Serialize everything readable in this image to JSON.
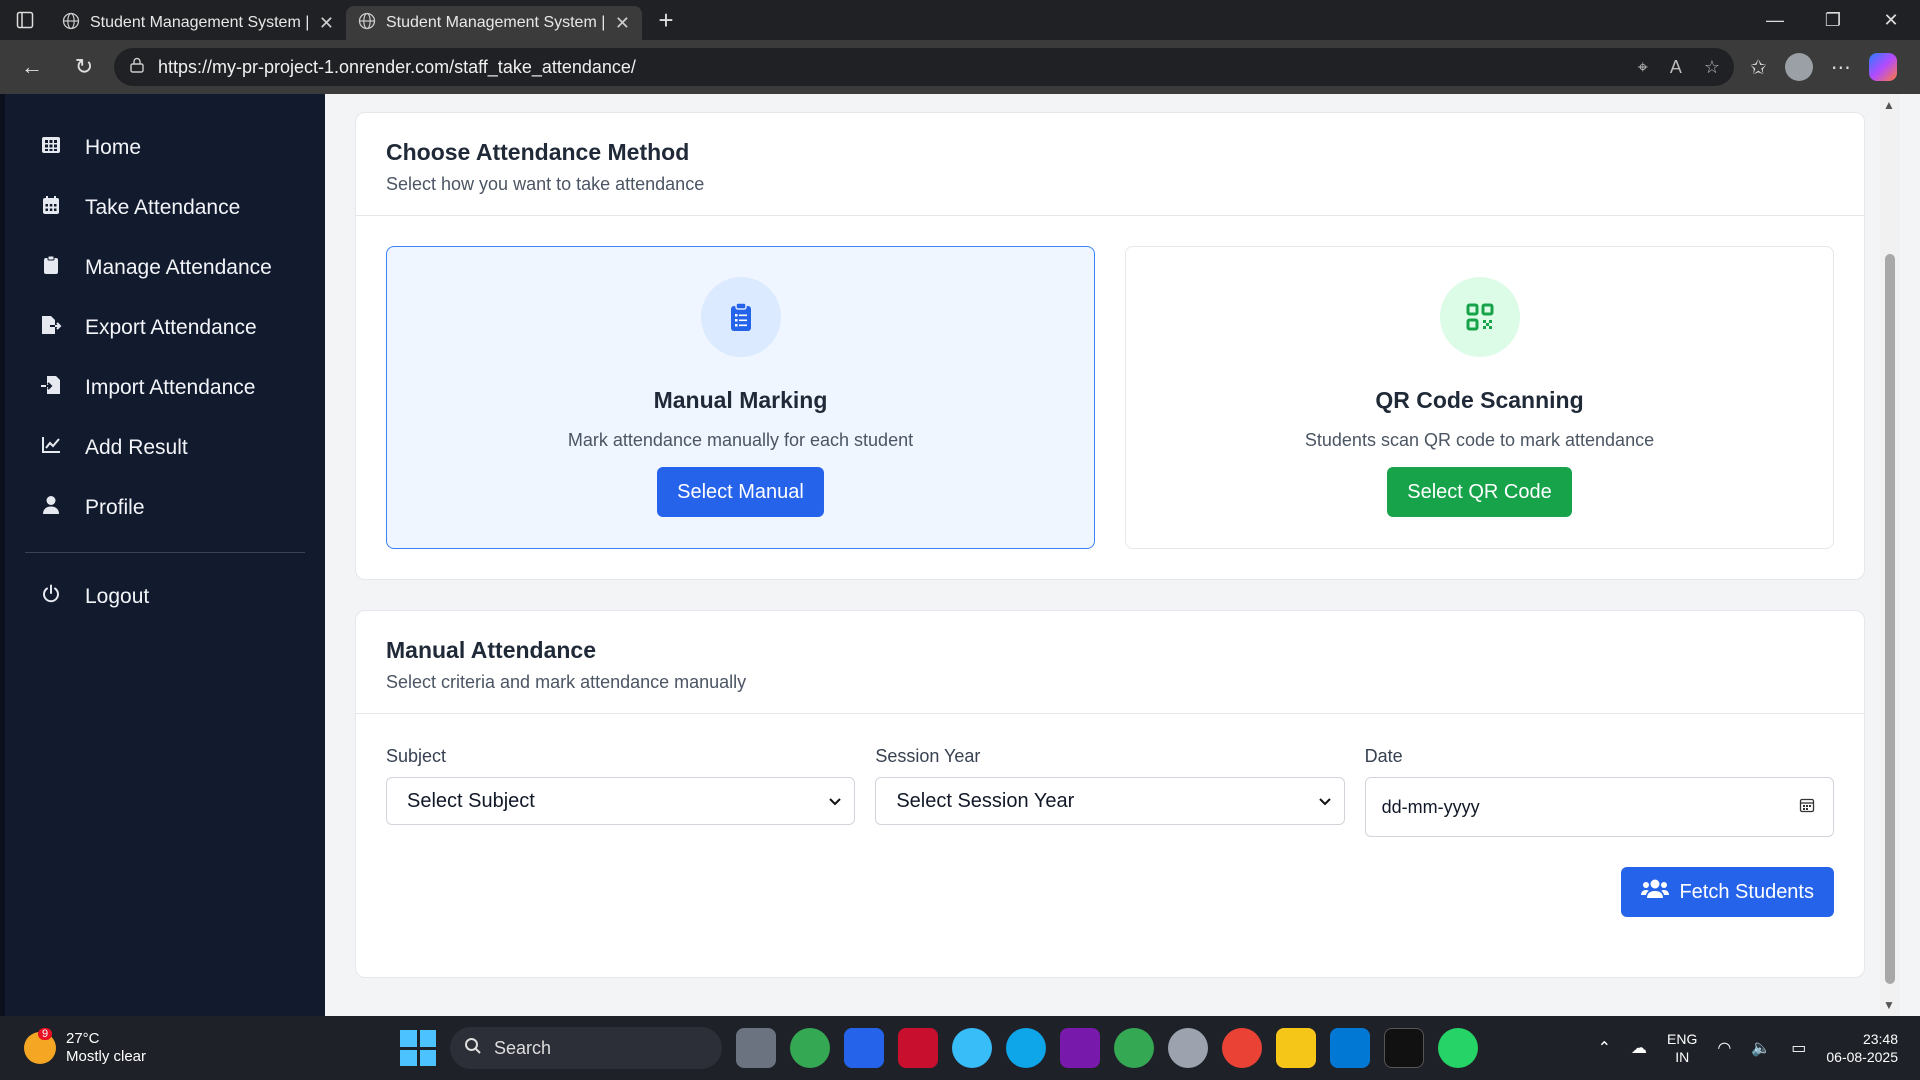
{
  "browser": {
    "tabs": [
      {
        "title": "Student Management System | Dashboard",
        "active": false
      },
      {
        "title": "Student Management System | Staff",
        "active": true
      }
    ],
    "url": "https://my-pr-project-1.onrender.com/staff_take_attendance/"
  },
  "sidebar": {
    "items": [
      {
        "label": "Home",
        "icon": "grid-icon"
      },
      {
        "label": "Take Attendance",
        "icon": "calendar-icon"
      },
      {
        "label": "Manage Attendance",
        "icon": "clipboard-icon"
      },
      {
        "label": "Export Attendance",
        "icon": "file-export-icon"
      },
      {
        "label": "Import Attendance",
        "icon": "file-import-icon"
      },
      {
        "label": "Add Result",
        "icon": "chart-line-icon"
      },
      {
        "label": "Profile",
        "icon": "user-icon"
      }
    ],
    "logout_label": "Logout"
  },
  "method_card": {
    "title": "Choose Attendance Method",
    "subtitle": "Select how you want to take attendance",
    "manual": {
      "title": "Manual Marking",
      "description": "Mark attendance manually for each student",
      "button": "Select Manual",
      "color": "#2563eb"
    },
    "qr": {
      "title": "QR Code Scanning",
      "description": "Students scan QR code to mark attendance",
      "button": "Select QR Code",
      "color": "#16a34a"
    }
  },
  "manual_card": {
    "title": "Manual Attendance",
    "subtitle": "Select criteria and mark attendance manually",
    "subject_label": "Subject",
    "subject_value": "Select Subject",
    "session_label": "Session Year",
    "session_value": "Select Session Year",
    "date_label": "Date",
    "date_placeholder": "dd-mm-yyyy",
    "fetch_button": "Fetch Students"
  },
  "taskbar": {
    "weather_badge": "9",
    "temperature": "27°C",
    "condition": "Mostly clear",
    "search_label": "Search",
    "language": "ENG",
    "region": "IN",
    "time": "23:48",
    "date": "06-08-2025"
  }
}
